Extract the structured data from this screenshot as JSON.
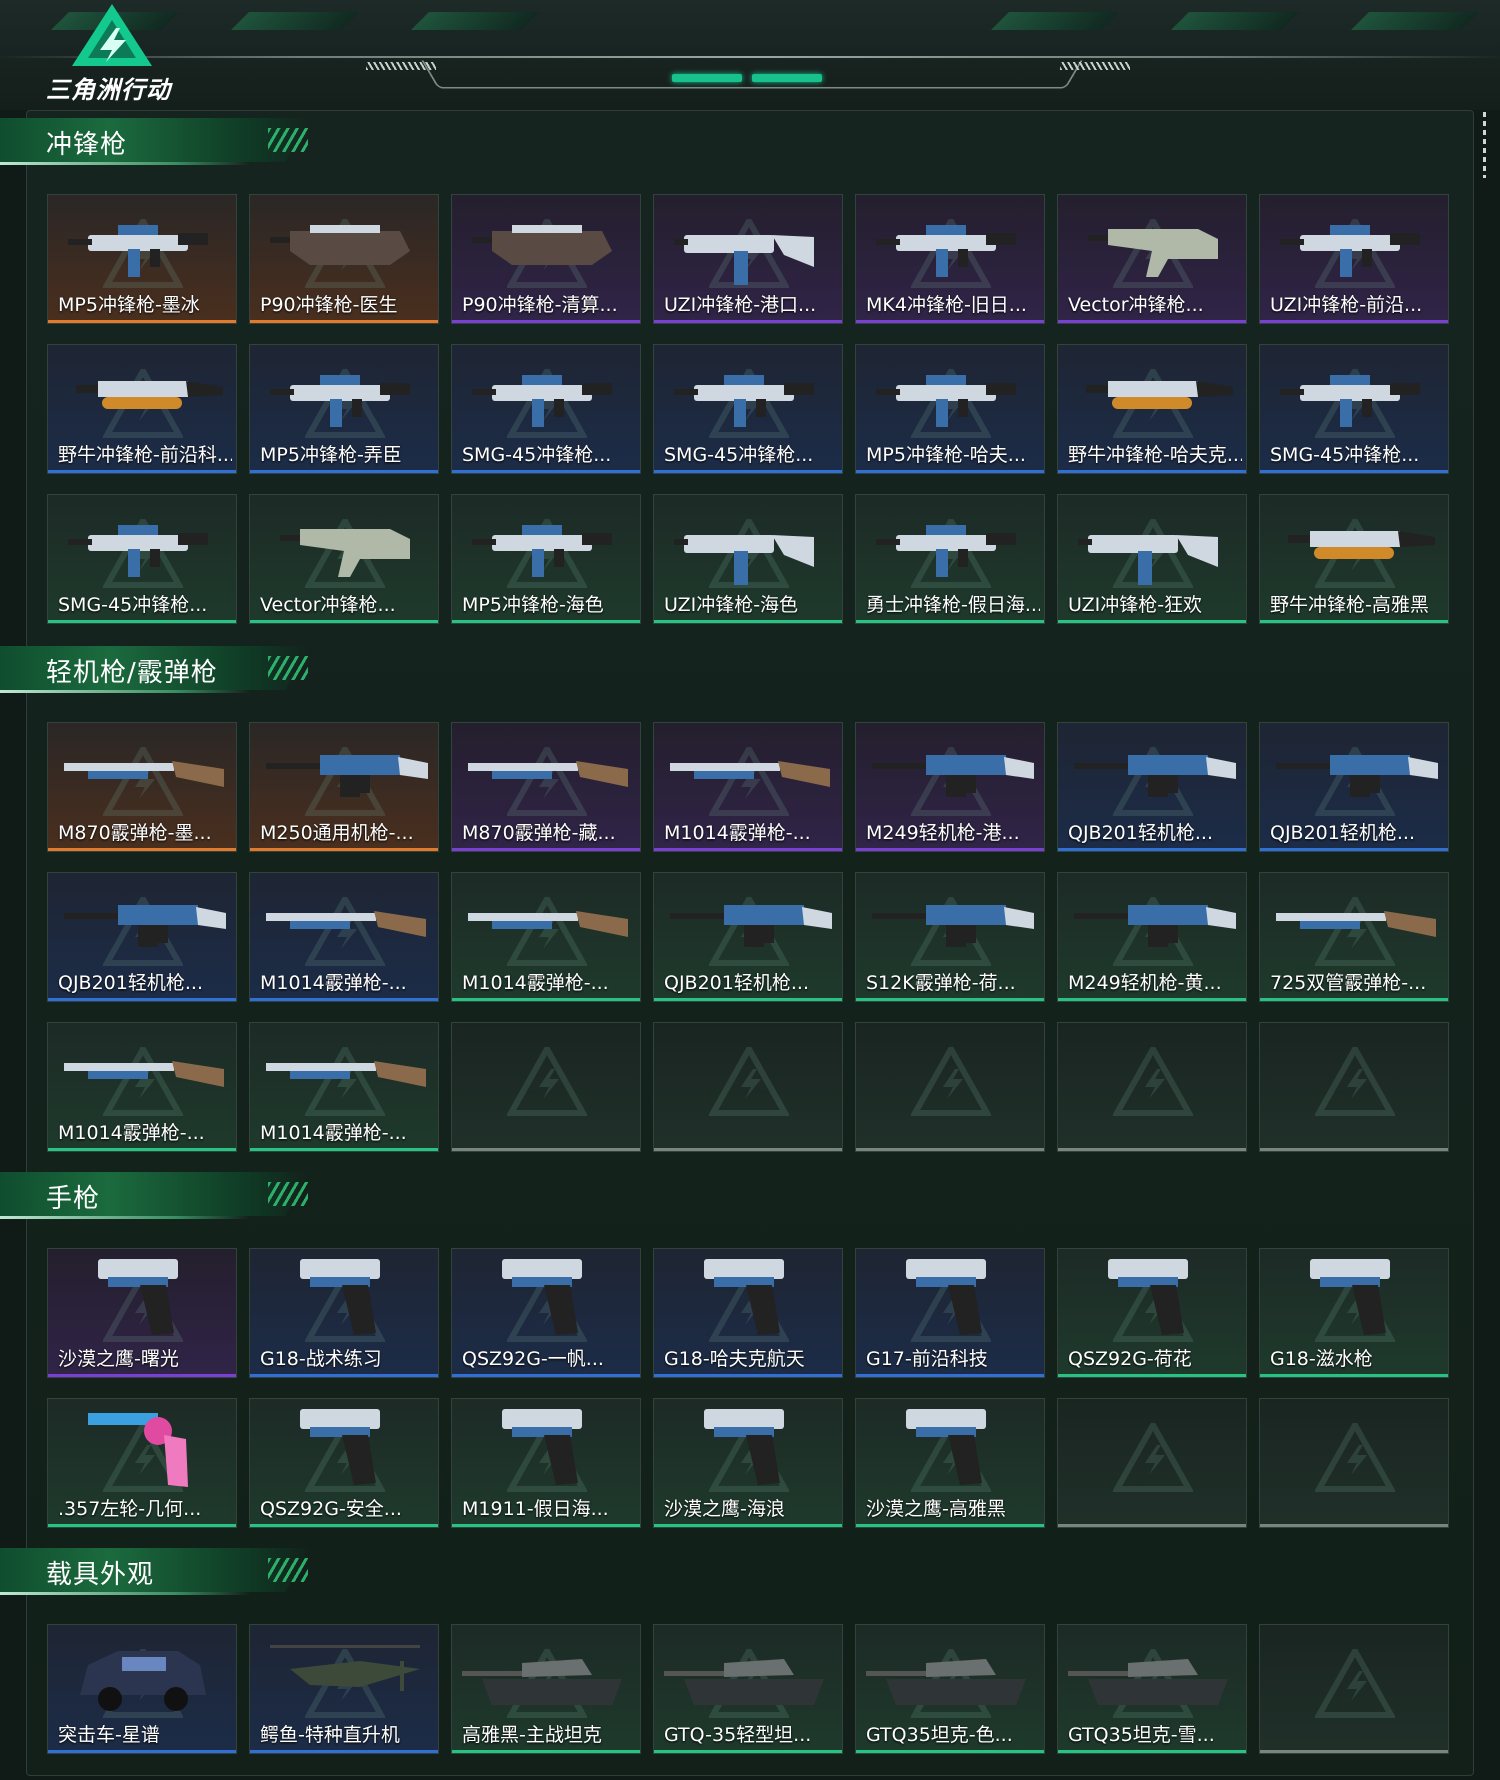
{
  "app": {
    "logo_text": "三角洲行动"
  },
  "sections": [
    {
      "title": "冲锋枪",
      "items": [
        {
          "label": "MP5冲锋枪-墨冰",
          "rarity": "gold",
          "art": "smg"
        },
        {
          "label": "P90冲锋枪-医生",
          "rarity": "gold",
          "art": "p90"
        },
        {
          "label": "P90冲锋枪-清算...",
          "rarity": "purple",
          "art": "p90"
        },
        {
          "label": "UZI冲锋枪-港口...",
          "rarity": "purple",
          "art": "uzi"
        },
        {
          "label": "MK4冲锋枪-旧日...",
          "rarity": "purple",
          "art": "smg"
        },
        {
          "label": "Vector冲锋枪...",
          "rarity": "purple",
          "art": "vector"
        },
        {
          "label": "UZI冲锋枪-前沿...",
          "rarity": "purple",
          "art": "smg"
        },
        {
          "label": "野牛冲锋枪-前沿科...",
          "rarity": "blue",
          "art": "bison"
        },
        {
          "label": "MP5冲锋枪-弄臣",
          "rarity": "blue",
          "art": "smg"
        },
        {
          "label": "SMG-45冲锋枪...",
          "rarity": "blue",
          "art": "smg"
        },
        {
          "label": "SMG-45冲锋枪...",
          "rarity": "blue",
          "art": "smg"
        },
        {
          "label": "MP5冲锋枪-哈夫...",
          "rarity": "blue",
          "art": "smg"
        },
        {
          "label": "野牛冲锋枪-哈夫克...",
          "rarity": "blue",
          "art": "bison"
        },
        {
          "label": "SMG-45冲锋枪...",
          "rarity": "blue",
          "art": "smg"
        },
        {
          "label": "SMG-45冲锋枪...",
          "rarity": "green",
          "art": "smg"
        },
        {
          "label": "Vector冲锋枪...",
          "rarity": "green",
          "art": "vector"
        },
        {
          "label": "MP5冲锋枪-海色",
          "rarity": "green",
          "art": "smg"
        },
        {
          "label": "UZI冲锋枪-海色",
          "rarity": "green",
          "art": "uzi"
        },
        {
          "label": "勇士冲锋枪-假日海...",
          "rarity": "green",
          "art": "smg"
        },
        {
          "label": "UZI冲锋枪-狂欢",
          "rarity": "green",
          "art": "uzi"
        },
        {
          "label": "野牛冲锋枪-高雅黑",
          "rarity": "green",
          "art": "bison"
        }
      ]
    },
    {
      "title": "轻机枪/霰弹枪",
      "items": [
        {
          "label": "M870霰弹枪-墨...",
          "rarity": "gold",
          "art": "shotgun"
        },
        {
          "label": "M250通用机枪-...",
          "rarity": "gold",
          "art": "lmg"
        },
        {
          "label": "M870霰弹枪-藏...",
          "rarity": "purple",
          "art": "shotgun"
        },
        {
          "label": "M1014霰弹枪-...",
          "rarity": "purple",
          "art": "shotgun"
        },
        {
          "label": "M249轻机枪-港...",
          "rarity": "purple",
          "art": "lmg"
        },
        {
          "label": "QJB201轻机枪...",
          "rarity": "blue",
          "art": "lmg"
        },
        {
          "label": "QJB201轻机枪...",
          "rarity": "blue",
          "art": "lmg"
        },
        {
          "label": "QJB201轻机枪...",
          "rarity": "blue",
          "art": "lmg"
        },
        {
          "label": "M1014霰弹枪-...",
          "rarity": "blue",
          "art": "shotgun"
        },
        {
          "label": "M1014霰弹枪-...",
          "rarity": "green",
          "art": "shotgun"
        },
        {
          "label": "QJB201轻机枪...",
          "rarity": "green",
          "art": "lmg"
        },
        {
          "label": "S12K霰弹枪-荷...",
          "rarity": "green",
          "art": "lmg"
        },
        {
          "label": "M249轻机枪-黄...",
          "rarity": "green",
          "art": "lmg"
        },
        {
          "label": "725双管霰弹枪-...",
          "rarity": "green",
          "art": "shotgun"
        },
        {
          "label": "M1014霰弹枪-...",
          "rarity": "green",
          "art": "shotgun"
        },
        {
          "label": "M1014霰弹枪-...",
          "rarity": "green",
          "art": "shotgun"
        },
        {
          "label": "",
          "rarity": "empty",
          "art": "none"
        },
        {
          "label": "",
          "rarity": "empty",
          "art": "none"
        },
        {
          "label": "",
          "rarity": "empty",
          "art": "none"
        },
        {
          "label": "",
          "rarity": "empty",
          "art": "none"
        },
        {
          "label": "",
          "rarity": "empty",
          "art": "none"
        }
      ]
    },
    {
      "title": "手枪",
      "items": [
        {
          "label": "沙漠之鹰-曙光",
          "rarity": "purple",
          "art": "pistol"
        },
        {
          "label": "G18-战术练习",
          "rarity": "blue",
          "art": "pistol"
        },
        {
          "label": "QSZ92G-一帆...",
          "rarity": "blue",
          "art": "pistol"
        },
        {
          "label": "G18-哈夫克航天",
          "rarity": "blue",
          "art": "pistol"
        },
        {
          "label": "G17-前沿科技",
          "rarity": "blue",
          "art": "pistol"
        },
        {
          "label": "QSZ92G-荷花",
          "rarity": "green",
          "art": "pistol"
        },
        {
          "label": "G18-滋水枪",
          "rarity": "green",
          "art": "pistol"
        },
        {
          "label": ".357左轮-几何...",
          "rarity": "green",
          "art": "revolver"
        },
        {
          "label": "QSZ92G-安全...",
          "rarity": "green",
          "art": "pistol"
        },
        {
          "label": "M1911-假日海...",
          "rarity": "green",
          "art": "pistol"
        },
        {
          "label": "沙漠之鹰-海浪",
          "rarity": "green",
          "art": "pistol"
        },
        {
          "label": "沙漠之鹰-高雅黑",
          "rarity": "green",
          "art": "pistol"
        },
        {
          "label": "",
          "rarity": "empty",
          "art": "none"
        },
        {
          "label": "",
          "rarity": "empty",
          "art": "none"
        }
      ]
    },
    {
      "title": "载具外观",
      "items": [
        {
          "label": "突击车-星谱",
          "rarity": "blue",
          "art": "car"
        },
        {
          "label": "鳄鱼-特种直升机",
          "rarity": "blue",
          "art": "heli"
        },
        {
          "label": "高雅黑-主战坦克",
          "rarity": "green",
          "art": "tank"
        },
        {
          "label": "GTQ-35轻型坦...",
          "rarity": "green",
          "art": "tank"
        },
        {
          "label": "GTQ35坦克-色...",
          "rarity": "green",
          "art": "tank"
        },
        {
          "label": "GTQ35坦克-雪...",
          "rarity": "green",
          "art": "tank"
        },
        {
          "label": "",
          "rarity": "empty",
          "art": "none"
        }
      ]
    }
  ],
  "colors": {
    "gold": "#e17a2a",
    "purple": "#7a3fd4",
    "blue": "#2f6fd6",
    "green": "#27c382",
    "accent": "#18c08b"
  }
}
